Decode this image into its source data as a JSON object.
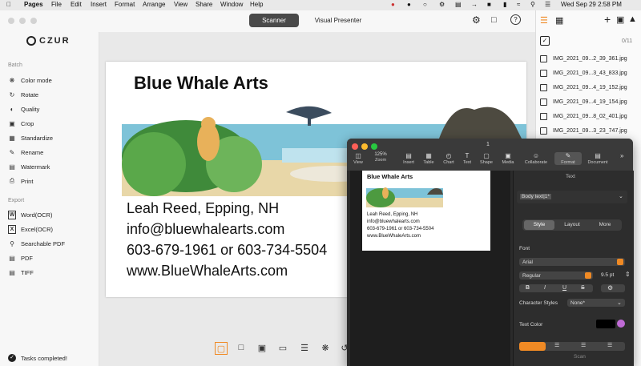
{
  "menubar": {
    "apple": "",
    "items": [
      "Pages",
      "File",
      "Edit",
      "Insert",
      "Format",
      "Arrange",
      "View",
      "Share",
      "Window",
      "Help"
    ],
    "clock": "Wed Sep 29  2:58 PM"
  },
  "app": {
    "brand": "CZUR",
    "tabs": [
      {
        "label": "Scanner",
        "active": true
      },
      {
        "label": "Visual Presenter",
        "active": false
      }
    ]
  },
  "sidebar": {
    "batch_label": "Batch",
    "batch_items": [
      {
        "label": "Color mode",
        "icon": "color-mode-icon"
      },
      {
        "label": "Rotate",
        "icon": "rotate-icon"
      },
      {
        "label": "Quality",
        "icon": "quality-icon"
      },
      {
        "label": "Crop",
        "icon": "crop-icon"
      },
      {
        "label": "Standardize",
        "icon": "standardize-icon"
      },
      {
        "label": "Rename",
        "icon": "rename-icon"
      },
      {
        "label": "Watermark",
        "icon": "watermark-icon"
      },
      {
        "label": "Print",
        "icon": "print-icon"
      }
    ],
    "export_label": "Export",
    "export_items": [
      {
        "label": "Word(OCR)",
        "icon": "word-icon"
      },
      {
        "label": "Excel(OCR)",
        "icon": "excel-icon"
      },
      {
        "label": "Searchable PDF",
        "icon": "searchable-pdf-icon"
      },
      {
        "label": "PDF",
        "icon": "pdf-icon"
      },
      {
        "label": "TIFF",
        "icon": "tiff-icon"
      }
    ],
    "status": "Tasks completed!"
  },
  "card": {
    "title": "Blue Whale Arts",
    "lines": [
      "Leah Reed, Epping, NH",
      "info@bluewhalearts.com",
      "603-679-1961 or 603-734-5504",
      "www.BlueWhaleArts.com"
    ]
  },
  "files": {
    "count": "0/11",
    "items": [
      "IMG_2021_09...2_39_361.jpg",
      "IMG_2021_09...3_43_833.jpg",
      "IMG_2021_09...4_19_152.jpg",
      "IMG_2021_09...4_19_154.jpg",
      "IMG_2021_09...8_02_401.jpg",
      "IMG_2021_09...3_23_747.jpg"
    ]
  },
  "pages_window": {
    "page_number": "1",
    "zoom": "125%",
    "toolbar": [
      "View",
      "Zoom",
      "Insert",
      "Table",
      "Chart",
      "Text",
      "Shape",
      "Media",
      "Collaborate",
      "Format",
      "Document"
    ],
    "doc_title": "Blue Whale Arts",
    "doc_lines": [
      "Leah Reed, Epping, NH",
      "info@bluewhalearts.com",
      "603-679-1961 or 603-734-5504",
      "www.BlueWhaleArts.com"
    ],
    "inspector": {
      "header": "Text",
      "paragraph_style": "Body text|1*",
      "tabs": [
        "Style",
        "Layout",
        "More"
      ],
      "font_label": "Font",
      "font_name": "Arial",
      "font_weight": "Regular",
      "font_size": "9.5 pt",
      "format_buttons": [
        "B",
        "I",
        "U",
        "S"
      ],
      "char_styles_label": "Character Styles",
      "char_styles_value": "None*",
      "text_color_label": "Text Color",
      "bottom_text": "Scan"
    }
  },
  "colors": {
    "accent_orange": "#f08a24",
    "active_tab": "#4a4a4a",
    "traffic_red": "#fe5f57",
    "traffic_yellow": "#febc2e",
    "traffic_green": "#28c840"
  }
}
